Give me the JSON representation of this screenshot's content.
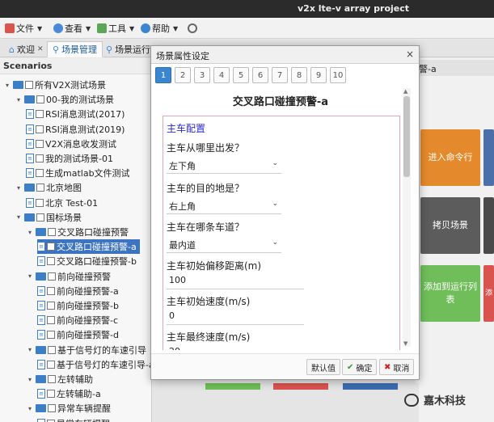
{
  "window": {
    "title": "v2x lte-v array project"
  },
  "menus": [
    {
      "label": "文件",
      "icon": "file-icon",
      "color": "#d9534f"
    },
    {
      "label": "查看",
      "icon": "view-icon",
      "color": "#4a8ad6"
    },
    {
      "label": "工具",
      "icon": "tools-icon",
      "color": "#5aa75a"
    },
    {
      "label": "帮助",
      "icon": "help-icon",
      "color": "#3b86d1"
    }
  ],
  "tabs": [
    {
      "label": "欢迎",
      "closable": true
    },
    {
      "label": "场景管理",
      "active": true
    },
    {
      "label": "场景运行"
    }
  ],
  "tree": {
    "header": "Scenarios",
    "nodes": [
      {
        "label": "所有V2X测试场景",
        "level": 0,
        "type": "folder"
      },
      {
        "label": "00-我的测试场景",
        "level": 1,
        "type": "folder"
      },
      {
        "label": "RSI消息测试(2017)",
        "level": 2,
        "type": "file"
      },
      {
        "label": "RSI消息测试(2019)",
        "level": 2,
        "type": "file"
      },
      {
        "label": "V2X消息收发测试",
        "level": 2,
        "type": "file"
      },
      {
        "label": "我的测试场景-01",
        "level": 2,
        "type": "file"
      },
      {
        "label": "生成matlab文件测试",
        "level": 2,
        "type": "file"
      },
      {
        "label": "北京地图",
        "level": 1,
        "type": "folder"
      },
      {
        "label": "北京 Test-01",
        "level": 2,
        "type": "file"
      },
      {
        "label": "国标场景",
        "level": 1,
        "type": "folder"
      },
      {
        "label": "交叉路口碰撞预警",
        "level": 2,
        "type": "folder"
      },
      {
        "label": "交叉路口碰撞预警-a",
        "level": 3,
        "type": "file",
        "selected": true
      },
      {
        "label": "交叉路口碰撞预警-b",
        "level": 3,
        "type": "file"
      },
      {
        "label": "前向碰撞预警",
        "level": 2,
        "type": "folder"
      },
      {
        "label": "前向碰撞预警-a",
        "level": 3,
        "type": "file"
      },
      {
        "label": "前向碰撞预警-b",
        "level": 3,
        "type": "file"
      },
      {
        "label": "前向碰撞预警-c",
        "level": 3,
        "type": "file"
      },
      {
        "label": "前向碰撞预警-d",
        "level": 3,
        "type": "file"
      },
      {
        "label": "基于信号灯的车速引导",
        "level": 2,
        "type": "folder"
      },
      {
        "label": "基于信号灯的车速引导-a",
        "level": 3,
        "type": "file"
      },
      {
        "label": "左转辅助",
        "level": 2,
        "type": "folder"
      },
      {
        "label": "左转辅助-a",
        "level": 3,
        "type": "file"
      },
      {
        "label": "异常车辆提醒",
        "level": 2,
        "type": "folder"
      },
      {
        "label": "异常车辆提醒",
        "level": 3,
        "type": "file"
      }
    ]
  },
  "right": {
    "tab_fragment": "警-a",
    "tiles": [
      {
        "label": "进入命令行",
        "color": "#e58a2c"
      },
      {
        "label": "拷贝场景",
        "color": "#5c5c5c"
      },
      {
        "label": "添加到运行列表",
        "color": "#6fbe5a"
      },
      {
        "label": "添",
        "color": "#d9534f"
      }
    ]
  },
  "dialog": {
    "title": "场景属性设定",
    "close": "×",
    "pages": [
      "1",
      "2",
      "3",
      "4",
      "5",
      "6",
      "7",
      "8",
      "9",
      "10"
    ],
    "heading": "交叉路口碰撞预警-a",
    "section": "主车配置",
    "fields": [
      {
        "label": "主车从哪里出发？",
        "kind": "select",
        "value": "左下角"
      },
      {
        "label": "主车的目的地是？",
        "kind": "select",
        "value": "右上角"
      },
      {
        "label": "主车在哪条车道？",
        "kind": "select",
        "value": "最内道"
      },
      {
        "label": "主车初始偏移距离(m)",
        "kind": "input",
        "value": "100"
      },
      {
        "label": "主车初始速度(m/s)",
        "kind": "input",
        "value": "0"
      },
      {
        "label": "主车最终速度(m/s)",
        "kind": "input",
        "value": "20"
      }
    ],
    "buttons": {
      "default": "默认值",
      "ok": "确定",
      "cancel": "取消"
    }
  },
  "watermark": {
    "text": "嘉木科技"
  }
}
